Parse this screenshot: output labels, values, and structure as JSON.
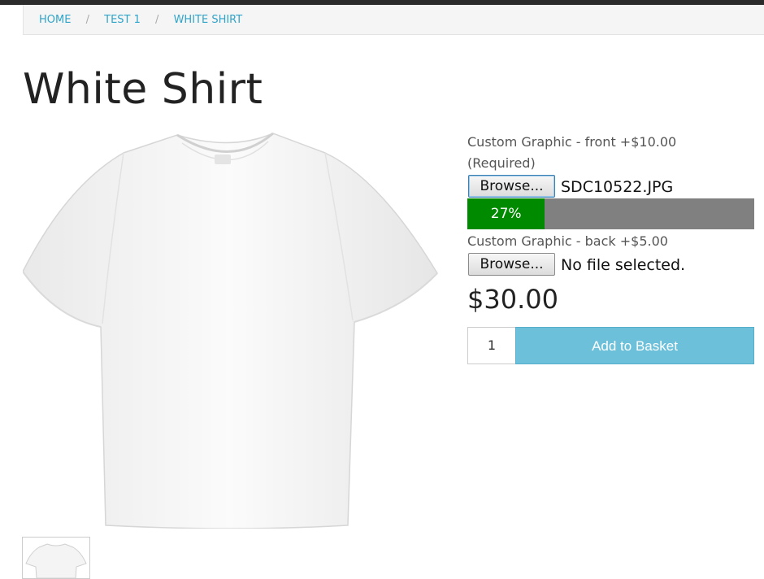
{
  "breadcrumb": {
    "items": [
      "HOME",
      "TEST 1",
      "WHITE SHIRT"
    ],
    "separator": "/"
  },
  "product": {
    "title": "White Shirt",
    "image": "white-tshirt",
    "price": "$30.00"
  },
  "options": {
    "front": {
      "label_line1": "Custom Graphic - front +$10.00",
      "label_line2": "(Required)",
      "browse_label": "Browse...",
      "file_name": "SDC10522.JPG",
      "progress_text": "27%",
      "progress_value": 0.27
    },
    "back": {
      "label": "Custom Graphic - back +$5.00",
      "browse_label": "Browse...",
      "file_name": "No file selected."
    }
  },
  "cart": {
    "quantity": "1",
    "add_label": "Add to Basket"
  },
  "colors": {
    "link": "#2fa4c9",
    "progress_fill": "#008a00",
    "progress_track": "#808080",
    "basket_button": "#6cc0da"
  }
}
